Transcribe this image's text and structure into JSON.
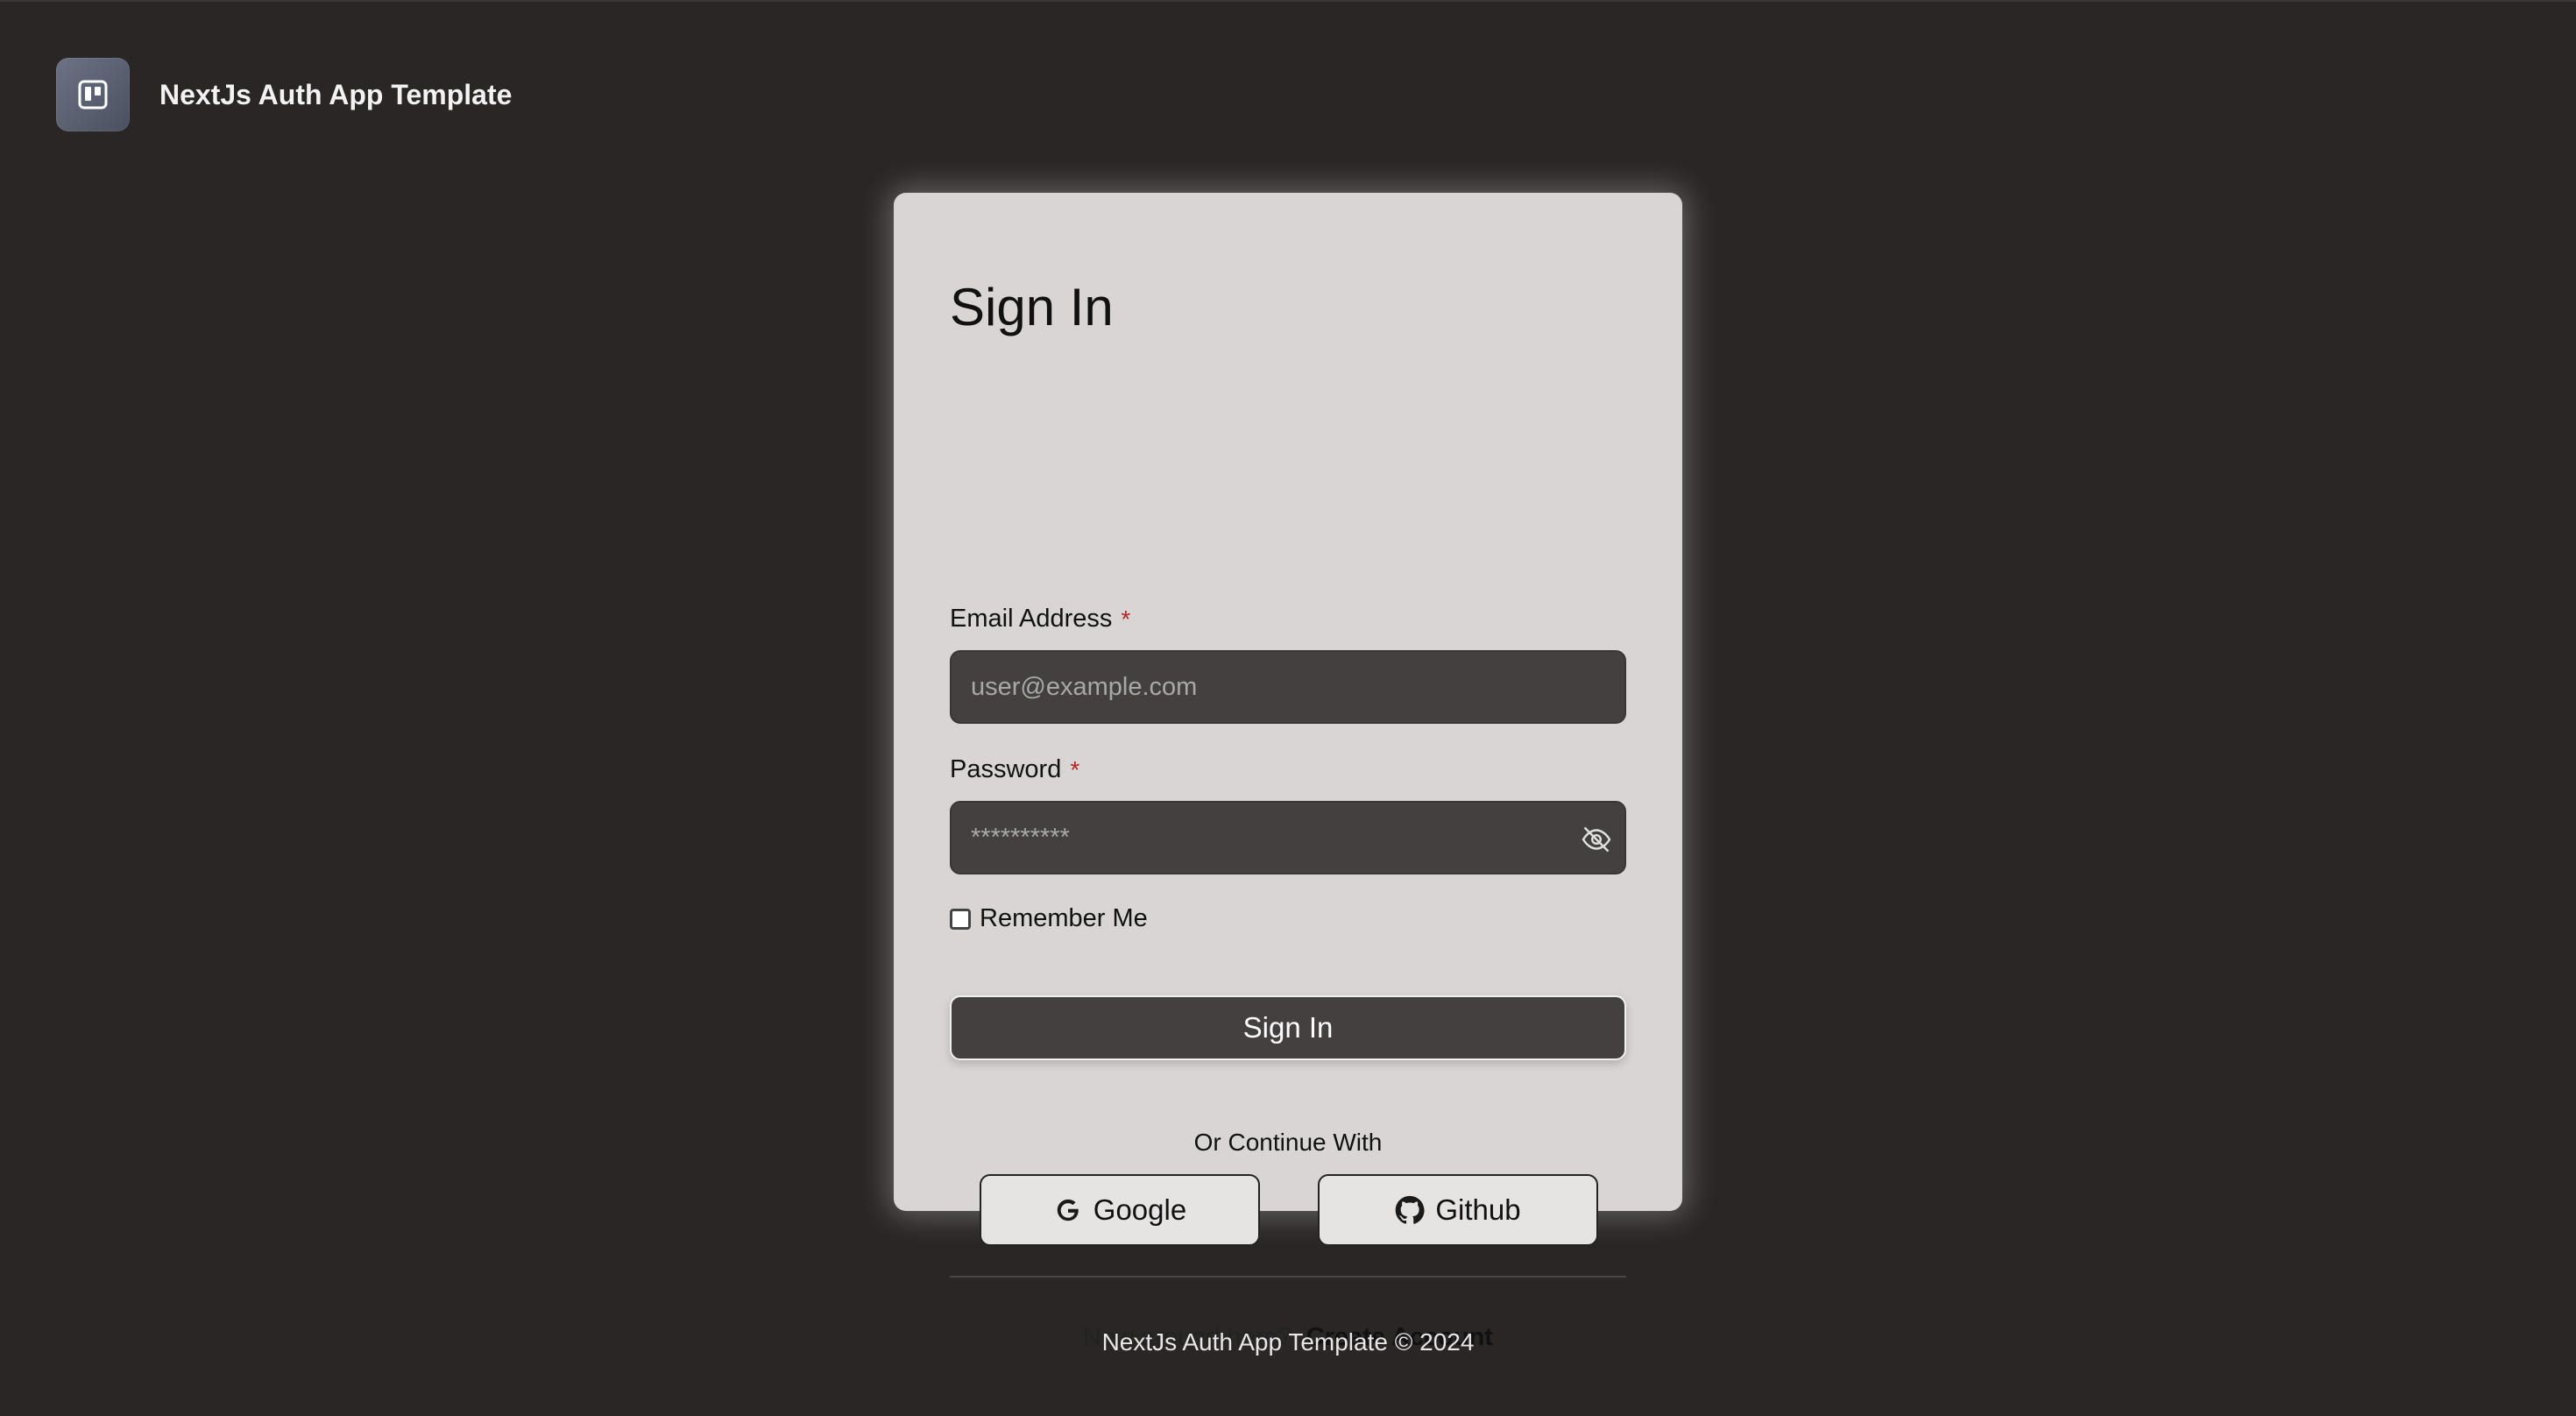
{
  "header": {
    "app_title": "NextJs Auth App Template",
    "logo_icon": "board-icon"
  },
  "form": {
    "title": "Sign In",
    "email": {
      "label": "Email Address",
      "required_mark": "*",
      "placeholder": "user@example.com",
      "value": ""
    },
    "password": {
      "label": "Password",
      "required_mark": "*",
      "placeholder": "**********",
      "value": "",
      "toggle_icon": "eye-off-icon"
    },
    "remember": {
      "label": "Remember Me",
      "checked": false
    },
    "submit_label": "Sign In",
    "divider_text": "Or Continue With",
    "social": [
      {
        "label": "Google",
        "icon": "google-icon"
      },
      {
        "label": "Github",
        "icon": "github-icon"
      }
    ],
    "signup_prompt": "New around here?",
    "signup_link": "Create Account"
  },
  "footer": {
    "text": "NextJs Auth App Template © 2024"
  },
  "colors": {
    "background": "#2a2625",
    "card": "#d9d5d4",
    "input": "#444040",
    "required": "#b32626"
  }
}
